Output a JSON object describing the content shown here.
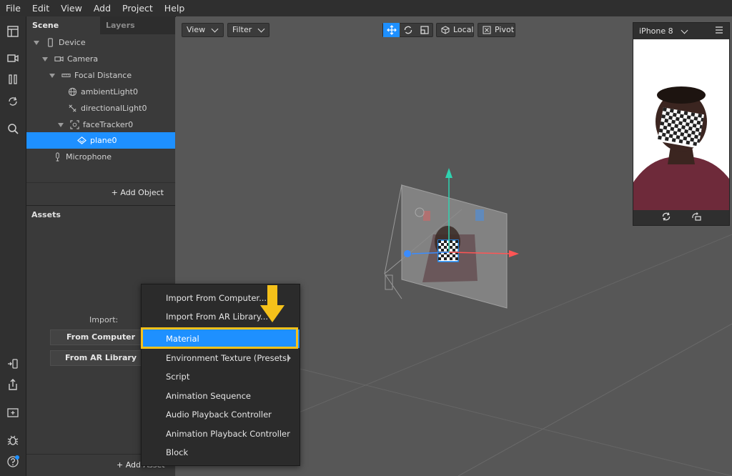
{
  "menubar": [
    "File",
    "Edit",
    "View",
    "Add",
    "Project",
    "Help"
  ],
  "scene_panel": {
    "tabs": [
      "Scene",
      "Layers"
    ],
    "tree": [
      {
        "label": "Device",
        "icon": "phone-icon",
        "indent": 0,
        "expanded": true
      },
      {
        "label": "Camera",
        "icon": "camera-icon",
        "indent": 1,
        "expanded": true
      },
      {
        "label": "Focal Distance",
        "icon": "ruler-icon",
        "indent": 2,
        "expanded": true
      },
      {
        "label": "ambientLight0",
        "icon": "globe-icon",
        "indent": 3
      },
      {
        "label": "directionalLight0",
        "icon": "directional-light-icon",
        "indent": 3
      },
      {
        "label": "faceTracker0",
        "icon": "face-tracker-icon",
        "indent": 3,
        "expanded": true
      },
      {
        "label": "plane0",
        "icon": "plane-icon",
        "indent": 4,
        "selected": true
      },
      {
        "label": "Microphone",
        "icon": "microphone-icon",
        "indent": 1
      }
    ],
    "add_object": "+ Add Object"
  },
  "assets_panel": {
    "title": "Assets",
    "import_label": "Import:",
    "from_computer": "From Computer",
    "from_ar_library": "From AR Library",
    "add_asset": "+ Add Asset"
  },
  "viewport": {
    "view_btn": "View",
    "filter_btn": "Filter",
    "local_btn": "Local",
    "pivot_btn": "Pivot"
  },
  "device_preview": {
    "device_name": "iPhone 8"
  },
  "context_menu": {
    "items": [
      {
        "label": "Import From Computer..."
      },
      {
        "label": "Import From AR Library..."
      },
      {
        "label": "Material",
        "highlighted": true
      },
      {
        "label": "Environment Texture (Presets)",
        "submenu": true
      },
      {
        "label": "Script"
      },
      {
        "label": "Animation Sequence"
      },
      {
        "label": "Audio Playback Controller"
      },
      {
        "label": "Animation Playback Controller"
      },
      {
        "label": "Block"
      }
    ]
  },
  "colors": {
    "accent": "#1e90ff",
    "callout": "#f5c11a"
  }
}
